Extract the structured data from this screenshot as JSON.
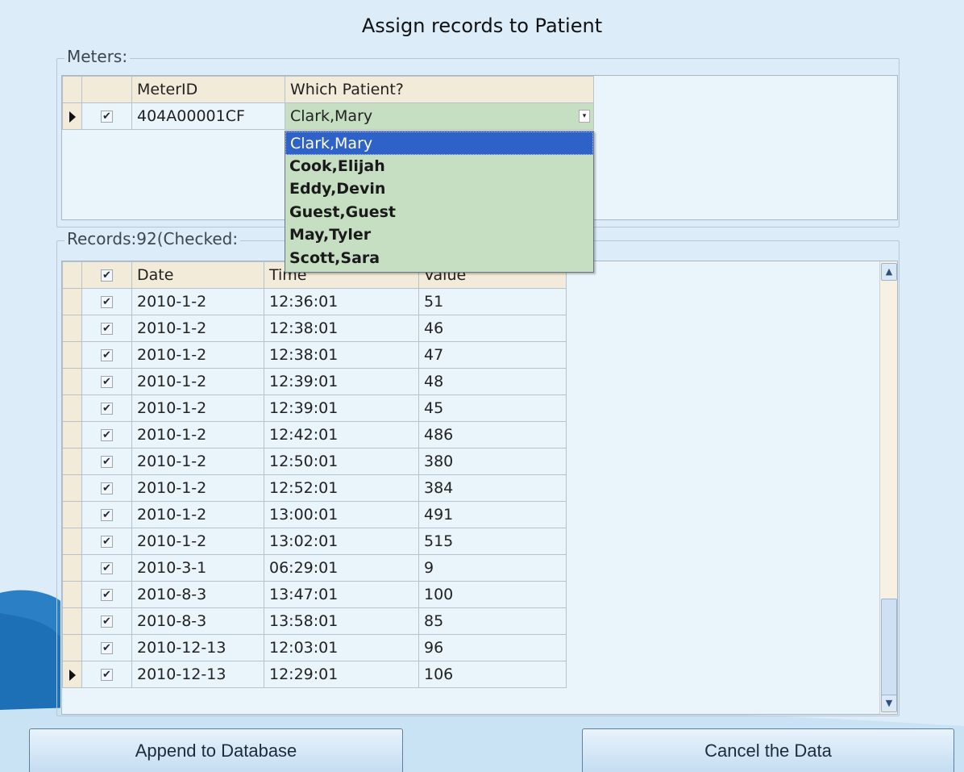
{
  "window": {
    "title": "Assign records to Patient"
  },
  "meters": {
    "legend": "Meters:",
    "columns": {
      "meter_id": "MeterID",
      "patient": "Which Patient?"
    },
    "row": {
      "meter_id": "404A00001CF",
      "patient": "Clark,Mary",
      "checked": true
    },
    "dropdown_options": [
      "Clark,Mary",
      "Cook,Elijah",
      "Eddy,Devin",
      "Guest,Guest",
      "May,Tyler",
      "Scott,Sara"
    ],
    "dropdown_selected": "Clark,Mary"
  },
  "records": {
    "legend": "Records:92(Checked:",
    "columns": {
      "date": "Date",
      "time": "Time",
      "value": "Value"
    },
    "rows": [
      {
        "date": "2010-1-2",
        "time": "12:36:01",
        "value": "51"
      },
      {
        "date": "2010-1-2",
        "time": "12:38:01",
        "value": "46"
      },
      {
        "date": "2010-1-2",
        "time": "12:38:01",
        "value": "47"
      },
      {
        "date": "2010-1-2",
        "time": "12:39:01",
        "value": "48"
      },
      {
        "date": "2010-1-2",
        "time": "12:39:01",
        "value": "45"
      },
      {
        "date": "2010-1-2",
        "time": "12:42:01",
        "value": "486"
      },
      {
        "date": "2010-1-2",
        "time": "12:50:01",
        "value": "380"
      },
      {
        "date": "2010-1-2",
        "time": "12:52:01",
        "value": "384"
      },
      {
        "date": "2010-1-2",
        "time": "13:00:01",
        "value": "491"
      },
      {
        "date": "2010-1-2",
        "time": "13:02:01",
        "value": "515"
      },
      {
        "date": "2010-3-1",
        "time": "06:29:01",
        "value": "9"
      },
      {
        "date": "2010-8-3",
        "time": "13:47:01",
        "value": "100"
      },
      {
        "date": "2010-8-3",
        "time": "13:58:01",
        "value": "85"
      },
      {
        "date": "2010-12-13",
        "time": "12:03:01",
        "value": "96"
      },
      {
        "date": "2010-12-13",
        "time": "12:29:01",
        "value": "106"
      }
    ]
  },
  "buttons": {
    "append": "Append to Database",
    "cancel": "Cancel the Data"
  },
  "icons": {
    "checkbox": "check-icon",
    "row_pointer": "row-pointer-icon"
  },
  "colors": {
    "header": "#f3ebd9",
    "selected_patient_cell": "#c6dfc3",
    "dropdown_highlight": "#2e62c8"
  }
}
